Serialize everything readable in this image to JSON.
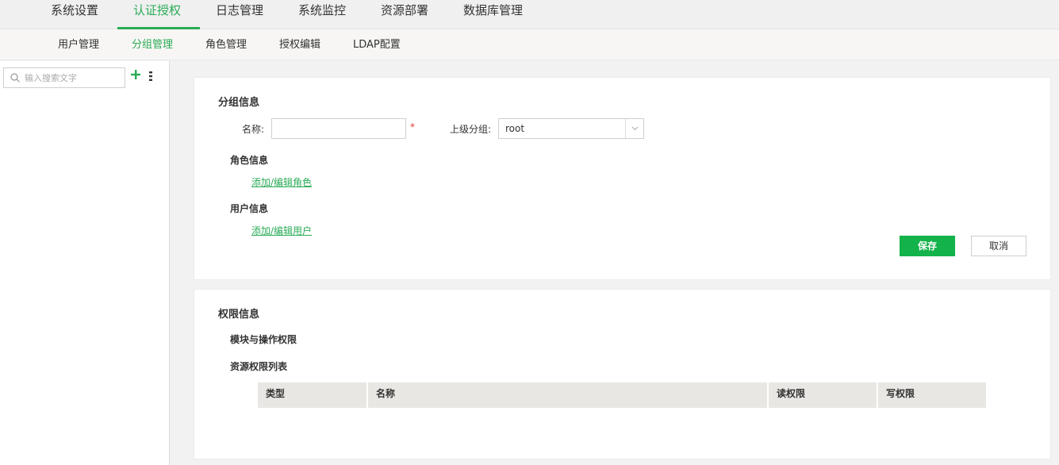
{
  "topnav": {
    "items": [
      "系统设置",
      "认证授权",
      "日志管理",
      "系统监控",
      "资源部署",
      "数据库管理"
    ],
    "active_index": 1
  },
  "subnav": {
    "items": [
      "用户管理",
      "分组管理",
      "角色管理",
      "授权编辑",
      "LDAP配置"
    ],
    "active_index": 1
  },
  "sidebar": {
    "search_placeholder": "输入搜索文字"
  },
  "group_info": {
    "title": "分组信息",
    "name_label": "名称:",
    "required_mark": "*",
    "name_value": "",
    "parent_label": "上级分组:",
    "parent_value": "root",
    "role_title": "角色信息",
    "role_link": "添加/编辑角色",
    "user_title": "用户信息",
    "user_link": "添加/编辑用户",
    "save_label": "保存",
    "cancel_label": "取消"
  },
  "permission_info": {
    "title": "权限信息",
    "module_title": "模块与操作权限",
    "resource_title": "资源权限列表",
    "columns": [
      "类型",
      "名称",
      "读权限",
      "写权限"
    ]
  },
  "colors": {
    "accent": "#2aab56",
    "save_button": "#13b24a",
    "required": "#e23b3b"
  }
}
